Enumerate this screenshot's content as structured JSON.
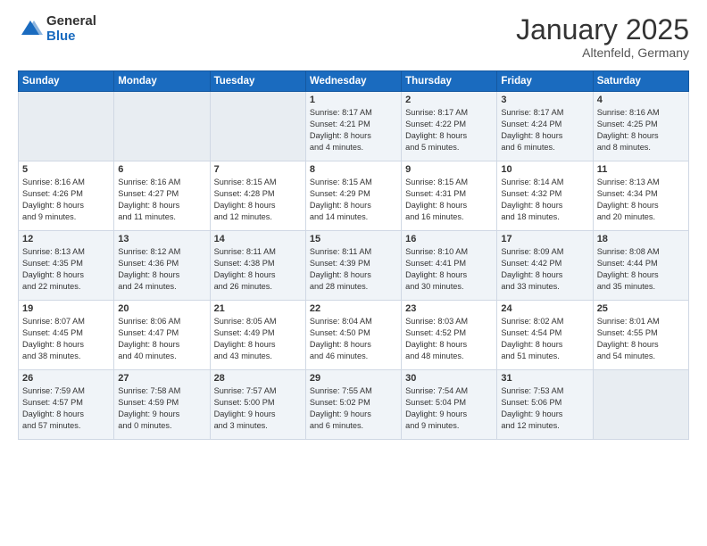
{
  "logo": {
    "general": "General",
    "blue": "Blue"
  },
  "header": {
    "month": "January 2025",
    "location": "Altenfeld, Germany"
  },
  "weekdays": [
    "Sunday",
    "Monday",
    "Tuesday",
    "Wednesday",
    "Thursday",
    "Friday",
    "Saturday"
  ],
  "weeks": [
    [
      {
        "day": "",
        "info": ""
      },
      {
        "day": "",
        "info": ""
      },
      {
        "day": "",
        "info": ""
      },
      {
        "day": "1",
        "info": "Sunrise: 8:17 AM\nSunset: 4:21 PM\nDaylight: 8 hours\nand 4 minutes."
      },
      {
        "day": "2",
        "info": "Sunrise: 8:17 AM\nSunset: 4:22 PM\nDaylight: 8 hours\nand 5 minutes."
      },
      {
        "day": "3",
        "info": "Sunrise: 8:17 AM\nSunset: 4:24 PM\nDaylight: 8 hours\nand 6 minutes."
      },
      {
        "day": "4",
        "info": "Sunrise: 8:16 AM\nSunset: 4:25 PM\nDaylight: 8 hours\nand 8 minutes."
      }
    ],
    [
      {
        "day": "5",
        "info": "Sunrise: 8:16 AM\nSunset: 4:26 PM\nDaylight: 8 hours\nand 9 minutes."
      },
      {
        "day": "6",
        "info": "Sunrise: 8:16 AM\nSunset: 4:27 PM\nDaylight: 8 hours\nand 11 minutes."
      },
      {
        "day": "7",
        "info": "Sunrise: 8:15 AM\nSunset: 4:28 PM\nDaylight: 8 hours\nand 12 minutes."
      },
      {
        "day": "8",
        "info": "Sunrise: 8:15 AM\nSunset: 4:29 PM\nDaylight: 8 hours\nand 14 minutes."
      },
      {
        "day": "9",
        "info": "Sunrise: 8:15 AM\nSunset: 4:31 PM\nDaylight: 8 hours\nand 16 minutes."
      },
      {
        "day": "10",
        "info": "Sunrise: 8:14 AM\nSunset: 4:32 PM\nDaylight: 8 hours\nand 18 minutes."
      },
      {
        "day": "11",
        "info": "Sunrise: 8:13 AM\nSunset: 4:34 PM\nDaylight: 8 hours\nand 20 minutes."
      }
    ],
    [
      {
        "day": "12",
        "info": "Sunrise: 8:13 AM\nSunset: 4:35 PM\nDaylight: 8 hours\nand 22 minutes."
      },
      {
        "day": "13",
        "info": "Sunrise: 8:12 AM\nSunset: 4:36 PM\nDaylight: 8 hours\nand 24 minutes."
      },
      {
        "day": "14",
        "info": "Sunrise: 8:11 AM\nSunset: 4:38 PM\nDaylight: 8 hours\nand 26 minutes."
      },
      {
        "day": "15",
        "info": "Sunrise: 8:11 AM\nSunset: 4:39 PM\nDaylight: 8 hours\nand 28 minutes."
      },
      {
        "day": "16",
        "info": "Sunrise: 8:10 AM\nSunset: 4:41 PM\nDaylight: 8 hours\nand 30 minutes."
      },
      {
        "day": "17",
        "info": "Sunrise: 8:09 AM\nSunset: 4:42 PM\nDaylight: 8 hours\nand 33 minutes."
      },
      {
        "day": "18",
        "info": "Sunrise: 8:08 AM\nSunset: 4:44 PM\nDaylight: 8 hours\nand 35 minutes."
      }
    ],
    [
      {
        "day": "19",
        "info": "Sunrise: 8:07 AM\nSunset: 4:45 PM\nDaylight: 8 hours\nand 38 minutes."
      },
      {
        "day": "20",
        "info": "Sunrise: 8:06 AM\nSunset: 4:47 PM\nDaylight: 8 hours\nand 40 minutes."
      },
      {
        "day": "21",
        "info": "Sunrise: 8:05 AM\nSunset: 4:49 PM\nDaylight: 8 hours\nand 43 minutes."
      },
      {
        "day": "22",
        "info": "Sunrise: 8:04 AM\nSunset: 4:50 PM\nDaylight: 8 hours\nand 46 minutes."
      },
      {
        "day": "23",
        "info": "Sunrise: 8:03 AM\nSunset: 4:52 PM\nDaylight: 8 hours\nand 48 minutes."
      },
      {
        "day": "24",
        "info": "Sunrise: 8:02 AM\nSunset: 4:54 PM\nDaylight: 8 hours\nand 51 minutes."
      },
      {
        "day": "25",
        "info": "Sunrise: 8:01 AM\nSunset: 4:55 PM\nDaylight: 8 hours\nand 54 minutes."
      }
    ],
    [
      {
        "day": "26",
        "info": "Sunrise: 7:59 AM\nSunset: 4:57 PM\nDaylight: 8 hours\nand 57 minutes."
      },
      {
        "day": "27",
        "info": "Sunrise: 7:58 AM\nSunset: 4:59 PM\nDaylight: 9 hours\nand 0 minutes."
      },
      {
        "day": "28",
        "info": "Sunrise: 7:57 AM\nSunset: 5:00 PM\nDaylight: 9 hours\nand 3 minutes."
      },
      {
        "day": "29",
        "info": "Sunrise: 7:55 AM\nSunset: 5:02 PM\nDaylight: 9 hours\nand 6 minutes."
      },
      {
        "day": "30",
        "info": "Sunrise: 7:54 AM\nSunset: 5:04 PM\nDaylight: 9 hours\nand 9 minutes."
      },
      {
        "day": "31",
        "info": "Sunrise: 7:53 AM\nSunset: 5:06 PM\nDaylight: 9 hours\nand 12 minutes."
      },
      {
        "day": "",
        "info": ""
      }
    ]
  ]
}
